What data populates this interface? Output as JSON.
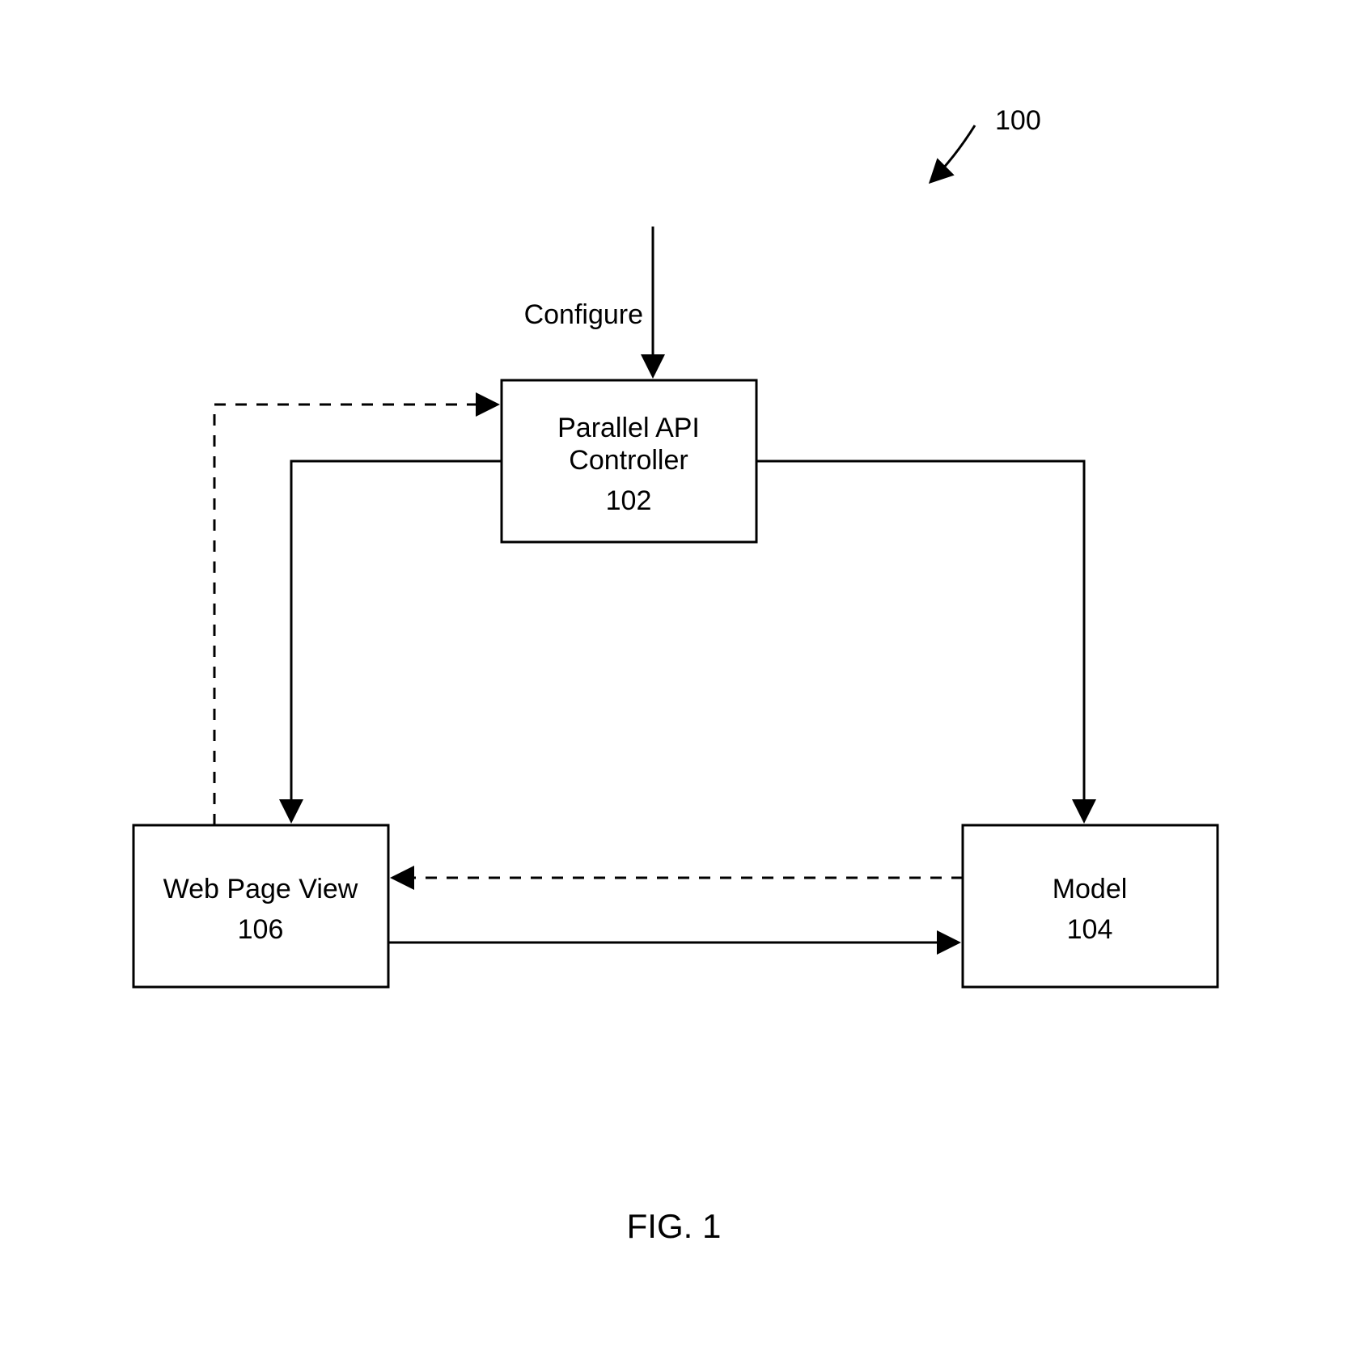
{
  "figure": {
    "caption": "FIG. 1",
    "reference_number": "100"
  },
  "nodes": {
    "controller": {
      "title": "Parallel API Controller",
      "ref": "102"
    },
    "view": {
      "title": "Web Page View",
      "ref": "106"
    },
    "model": {
      "title": "Model",
      "ref": "104"
    }
  },
  "labels": {
    "configure_arrow": "Configure"
  }
}
